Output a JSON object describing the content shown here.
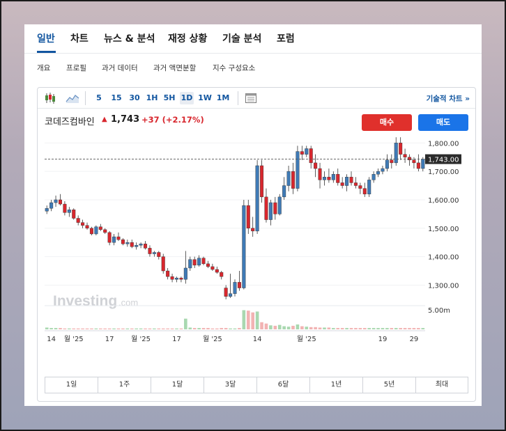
{
  "main_tabs": [
    "일반",
    "차트",
    "뉴스 & 분석",
    "재정 상황",
    "기술 분석",
    "포럼"
  ],
  "sub_tabs": [
    "개요",
    "프로필",
    "과거 데이터",
    "과거 액면분할",
    "지수 구성요소"
  ],
  "toolbar": {
    "intervals": [
      "5",
      "15",
      "30",
      "1H",
      "5H",
      "1D",
      "1W",
      "1M"
    ],
    "active_interval": "1D",
    "technical_chart_link": "기술적 차트 »",
    "icons": [
      "candlestick-icon",
      "area-chart-icon",
      "table-icon"
    ]
  },
  "symbol": {
    "name": "코데즈컴바인",
    "price": "1,743",
    "change": "+37",
    "change_pct": "(+2.17%)"
  },
  "buttons": {
    "buy": "매수",
    "sell": "매도"
  },
  "watermark": {
    "brand": "Investing",
    "suffix": ".com"
  },
  "ranges": [
    "1일",
    "1주",
    "1달",
    "3달",
    "6달",
    "1년",
    "5년",
    "최대"
  ],
  "colors": {
    "up": "#d8272e",
    "down": "#3f7ab5",
    "accent": "#1256a0",
    "buy": "#e0302c",
    "sell": "#1a74e8"
  },
  "chart_data": {
    "type": "candlestick",
    "last_price_label": "1,743.00",
    "last_price": 1743,
    "y_ticks": [
      1300,
      1400,
      1500,
      1600,
      1700,
      1800
    ],
    "y_tick_labels": [
      "1,300.00",
      "1,400.00",
      "1,500.00",
      "1,600.00",
      "1,700.00",
      "1,800.00"
    ],
    "ylim": [
      1235,
      1835
    ],
    "volume_label": "5.00m",
    "x_tick_labels": [
      "14",
      "월 '25",
      "17",
      "월 '25",
      "17",
      "월 '25",
      "14",
      "월 '25",
      "19",
      "29"
    ],
    "candles": [
      [
        1560,
        1580,
        1550,
        1570
      ],
      [
        1570,
        1600,
        1560,
        1590
      ],
      [
        1590,
        1615,
        1575,
        1600
      ],
      [
        1600,
        1620,
        1580,
        1585
      ],
      [
        1585,
        1595,
        1545,
        1555
      ],
      [
        1555,
        1575,
        1540,
        1565
      ],
      [
        1565,
        1570,
        1530,
        1535
      ],
      [
        1535,
        1545,
        1510,
        1520
      ],
      [
        1520,
        1530,
        1500,
        1510
      ],
      [
        1510,
        1520,
        1495,
        1500
      ],
      [
        1500,
        1505,
        1475,
        1480
      ],
      [
        1480,
        1510,
        1475,
        1505
      ],
      [
        1505,
        1515,
        1490,
        1495
      ],
      [
        1495,
        1500,
        1480,
        1485
      ],
      [
        1485,
        1490,
        1440,
        1450
      ],
      [
        1450,
        1480,
        1440,
        1470
      ],
      [
        1470,
        1485,
        1455,
        1460
      ],
      [
        1460,
        1465,
        1440,
        1445
      ],
      [
        1445,
        1460,
        1435,
        1450
      ],
      [
        1450,
        1460,
        1430,
        1435
      ],
      [
        1435,
        1450,
        1425,
        1440
      ],
      [
        1440,
        1450,
        1430,
        1445
      ],
      [
        1445,
        1455,
        1425,
        1430
      ],
      [
        1430,
        1440,
        1400,
        1410
      ],
      [
        1410,
        1420,
        1400,
        1415
      ],
      [
        1415,
        1420,
        1390,
        1400
      ],
      [
        1400,
        1410,
        1340,
        1350
      ],
      [
        1350,
        1360,
        1320,
        1330
      ],
      [
        1330,
        1340,
        1310,
        1320
      ],
      [
        1320,
        1330,
        1310,
        1325
      ],
      [
        1325,
        1330,
        1310,
        1320
      ],
      [
        1320,
        1420,
        1305,
        1360
      ],
      [
        1360,
        1400,
        1350,
        1390
      ],
      [
        1390,
        1400,
        1360,
        1370
      ],
      [
        1370,
        1405,
        1365,
        1395
      ],
      [
        1395,
        1400,
        1370,
        1375
      ],
      [
        1375,
        1385,
        1360,
        1365
      ],
      [
        1365,
        1375,
        1350,
        1355
      ],
      [
        1355,
        1365,
        1340,
        1345
      ],
      [
        1345,
        1350,
        1320,
        1330
      ],
      [
        1290,
        1300,
        1250,
        1260
      ],
      [
        1260,
        1340,
        1255,
        1270
      ],
      [
        1270,
        1320,
        1260,
        1310
      ],
      [
        1310,
        1350,
        1280,
        1290
      ],
      [
        1290,
        1600,
        1285,
        1580
      ],
      [
        1580,
        1600,
        1480,
        1500
      ],
      [
        1500,
        1540,
        1470,
        1490
      ],
      [
        1490,
        1740,
        1480,
        1720
      ],
      [
        1720,
        1740,
        1590,
        1610
      ],
      [
        1610,
        1640,
        1520,
        1530
      ],
      [
        1530,
        1600,
        1510,
        1590
      ],
      [
        1590,
        1610,
        1530,
        1550
      ],
      [
        1550,
        1620,
        1545,
        1610
      ],
      [
        1610,
        1680,
        1600,
        1650
      ],
      [
        1650,
        1720,
        1630,
        1700
      ],
      [
        1700,
        1730,
        1620,
        1640
      ],
      [
        1640,
        1790,
        1630,
        1770
      ],
      [
        1770,
        1790,
        1740,
        1760
      ],
      [
        1760,
        1790,
        1750,
        1780
      ],
      [
        1780,
        1790,
        1710,
        1730
      ],
      [
        1730,
        1760,
        1680,
        1710
      ],
      [
        1710,
        1730,
        1640,
        1670
      ],
      [
        1670,
        1700,
        1650,
        1680
      ],
      [
        1680,
        1710,
        1660,
        1670
      ],
      [
        1670,
        1700,
        1660,
        1690
      ],
      [
        1690,
        1710,
        1650,
        1660
      ],
      [
        1660,
        1680,
        1640,
        1650
      ],
      [
        1650,
        1690,
        1630,
        1680
      ],
      [
        1680,
        1700,
        1650,
        1660
      ],
      [
        1660,
        1680,
        1640,
        1650
      ],
      [
        1650,
        1660,
        1620,
        1640
      ],
      [
        1640,
        1660,
        1610,
        1620
      ],
      [
        1620,
        1680,
        1610,
        1670
      ],
      [
        1670,
        1700,
        1660,
        1690
      ],
      [
        1690,
        1710,
        1680,
        1700
      ],
      [
        1700,
        1720,
        1690,
        1710
      ],
      [
        1710,
        1760,
        1700,
        1740
      ],
      [
        1740,
        1760,
        1710,
        1730
      ],
      [
        1730,
        1820,
        1720,
        1800
      ],
      [
        1800,
        1820,
        1740,
        1760
      ],
      [
        1760,
        1780,
        1730,
        1750
      ],
      [
        1750,
        1760,
        1720,
        1740
      ],
      [
        1740,
        1750,
        1710,
        1730
      ],
      [
        1730,
        1760,
        1700,
        1710
      ],
      [
        1710,
        1750,
        1700,
        1743
      ]
    ],
    "volumes": [
      0.4,
      0.3,
      0.3,
      0.3,
      0.2,
      0.2,
      0.2,
      0.2,
      0.2,
      0.2,
      0.2,
      0.2,
      0.2,
      0.2,
      0.2,
      0.2,
      0.2,
      0.2,
      0.2,
      0.2,
      0.2,
      0.2,
      0.2,
      0.2,
      0.2,
      0.2,
      0.2,
      0.2,
      0.2,
      0.2,
      0.2,
      2.4,
      0.4,
      0.3,
      0.3,
      0.3,
      0.3,
      0.2,
      0.2,
      0.3,
      0.3,
      0.2,
      0.2,
      0.3,
      4.3,
      4.2,
      3.8,
      4.0,
      1.6,
      1.3,
      0.9,
      0.8,
      1.0,
      0.7,
      0.6,
      0.8,
      1.1,
      0.7,
      0.6,
      0.5,
      0.5,
      0.4,
      0.4,
      0.4,
      0.3,
      0.3,
      0.3,
      0.3,
      0.3,
      0.3,
      0.3,
      0.3,
      0.3,
      0.3,
      0.3,
      0.3,
      0.3,
      0.3,
      0.3,
      0.3,
      0.3,
      0.3,
      0.3,
      0.3,
      0.3
    ]
  }
}
